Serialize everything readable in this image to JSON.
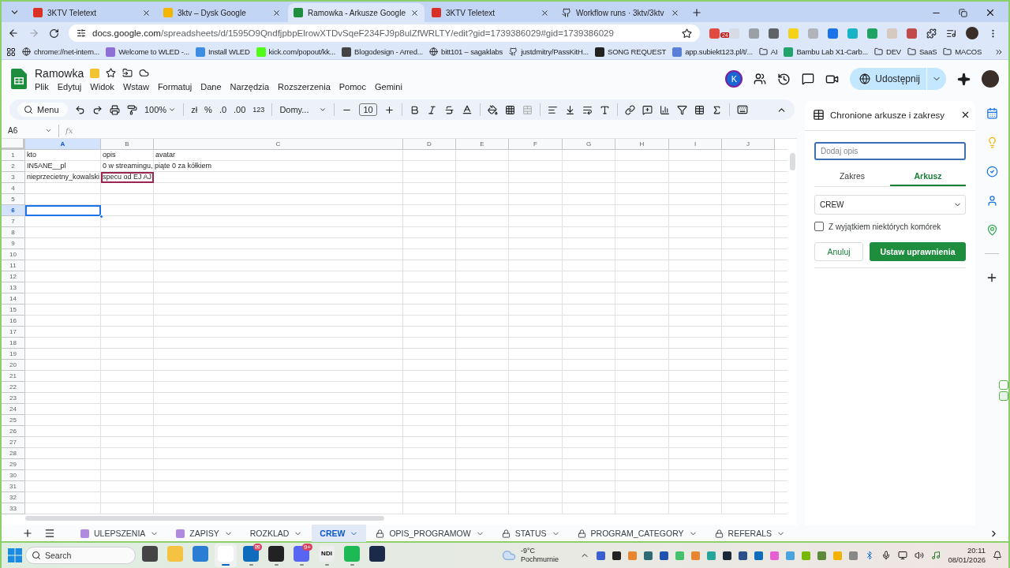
{
  "browser": {
    "tabs": [
      {
        "kind": "teletext",
        "title": "3KTV Teletext",
        "selected": false
      },
      {
        "kind": "drive",
        "title": "3ktv – Dysk Google",
        "selected": false
      },
      {
        "kind": "sheets",
        "title": "Ramowka - Arkusze Google",
        "selected": true
      },
      {
        "kind": "teletext",
        "title": "3KTV Teletext",
        "selected": false
      },
      {
        "kind": "github",
        "title": "Workflow runs · 3ktv/3ktv",
        "selected": false
      }
    ],
    "url_host": "docs.google.com",
    "url_path": "/spreadsheets/d/1595O9QndfjpbpElrowXTDvSqeF234FJ9p8ulZfWRLTY/edit?gid=1739386029#gid=1739386029",
    "extension_badge": "24",
    "bookmarks": [
      {
        "kind": "globe",
        "label": "chrome://net-intern..."
      },
      {
        "kind": "wled",
        "label": "Welcome to WLED -..."
      },
      {
        "kind": "app",
        "label": "Install WLED"
      },
      {
        "kind": "kick",
        "label": "kick.com/popout/kk..."
      },
      {
        "kind": "art",
        "label": "Blogodesign - Arred..."
      },
      {
        "kind": "globe",
        "label": "bitt101 – sagaklabs"
      },
      {
        "kind": "github",
        "label": "justdmitry/PassKitH..."
      },
      {
        "kind": "shield",
        "label": "SONG REQUEST"
      },
      {
        "kind": "numbers",
        "label": "app.subiekt123.pl/t/..."
      },
      {
        "kind": "folder",
        "label": "AI"
      },
      {
        "kind": "bambu",
        "label": "Bambu Lab X1-Carb..."
      },
      {
        "kind": "folder",
        "label": "DEV"
      },
      {
        "kind": "folder",
        "label": "SaaS"
      },
      {
        "kind": "folder",
        "label": "MACOS"
      }
    ]
  },
  "document": {
    "title": "Ramowka",
    "menus": [
      "Plik",
      "Edytuj",
      "Widok",
      "Wstaw",
      "Formatuj",
      "Dane",
      "Narzędzia",
      "Rozszerzenia",
      "Pomoc",
      "Gemini"
    ],
    "collaborator_initial": "K",
    "share_label": "Udostępnij"
  },
  "toolbar": {
    "search_label": "Menu",
    "zoom": "100%",
    "currency": "zł",
    "percent": "%",
    "decrease_decimals": ".0",
    "increase_decimals": ".00",
    "number_format": "123",
    "font": "Domy...",
    "font_size": "10"
  },
  "formula_bar": {
    "cell_ref": "A6",
    "fx": "fx"
  },
  "table": {
    "columns": [
      {
        "label": "A",
        "selected": true
      },
      {
        "label": "B",
        "selected": false
      },
      {
        "label": "C",
        "selected": false
      },
      {
        "label": "D",
        "selected": false
      },
      {
        "label": "E",
        "selected": false
      },
      {
        "label": "F",
        "selected": false
      },
      {
        "label": "G",
        "selected": false
      },
      {
        "label": "H",
        "selected": false
      },
      {
        "label": "I",
        "selected": false
      },
      {
        "label": "J",
        "selected": false
      }
    ],
    "rows": [
      {
        "number": "1",
        "selected": false,
        "cells": [
          {
            "text": "kto",
            "outlined": false
          },
          {
            "text": "opis",
            "outlined": false
          },
          {
            "text": "avatar",
            "outlined": false
          }
        ]
      },
      {
        "number": "2",
        "selected": false,
        "cells": [
          {
            "text": "IN5ANE__pl",
            "outlined": false
          },
          {
            "text": "0 w streamingu, piąte 0 za kółkiem",
            "outlined": false
          }
        ]
      },
      {
        "number": "3",
        "selected": false,
        "cells": [
          {
            "text": "nieprzecietny_kowalski",
            "outlined": false
          },
          {
            "text": "specu od EJ AJ",
            "outlined": true
          }
        ]
      },
      {
        "number": "4",
        "selected": false,
        "cells": []
      },
      {
        "number": "5",
        "selected": false,
        "cells": []
      },
      {
        "number": "6",
        "selected": true,
        "cells": []
      },
      {
        "number": "7",
        "selected": false,
        "cells": []
      },
      {
        "number": "8",
        "selected": false,
        "cells": []
      },
      {
        "number": "9",
        "selected": false,
        "cells": []
      },
      {
        "number": "10",
        "selected": false,
        "cells": []
      },
      {
        "number": "11",
        "selected": false,
        "cells": []
      },
      {
        "number": "12",
        "selected": false,
        "cells": []
      },
      {
        "number": "13",
        "selected": false,
        "cells": []
      },
      {
        "number": "14",
        "selected": false,
        "cells": []
      },
      {
        "number": "15",
        "selected": false,
        "cells": []
      },
      {
        "number": "16",
        "selected": false,
        "cells": []
      },
      {
        "number": "17",
        "selected": false,
        "cells": []
      },
      {
        "number": "18",
        "selected": false,
        "cells": []
      },
      {
        "number": "19",
        "selected": false,
        "cells": []
      },
      {
        "number": "20",
        "selected": false,
        "cells": []
      },
      {
        "number": "21",
        "selected": false,
        "cells": []
      },
      {
        "number": "22",
        "selected": false,
        "cells": []
      },
      {
        "number": "23",
        "selected": false,
        "cells": []
      },
      {
        "number": "24",
        "selected": false,
        "cells": []
      },
      {
        "number": "25",
        "selected": false,
        "cells": []
      },
      {
        "number": "26",
        "selected": false,
        "cells": []
      },
      {
        "number": "27",
        "selected": false,
        "cells": []
      },
      {
        "number": "28",
        "selected": false,
        "cells": []
      },
      {
        "number": "29",
        "selected": false,
        "cells": []
      },
      {
        "number": "30",
        "selected": false,
        "cells": []
      },
      {
        "number": "31",
        "selected": false,
        "cells": []
      },
      {
        "number": "32",
        "selected": false,
        "cells": []
      },
      {
        "number": "33",
        "selected": false,
        "cells": []
      }
    ]
  },
  "side_panel": {
    "title": "Chronione arkusze i zakresy",
    "description_placeholder": "Dodaj opis",
    "tabs": [
      {
        "label": "Zakres",
        "selected": false
      },
      {
        "label": "Arkusz",
        "selected": true
      }
    ],
    "sheet_select": "CREW",
    "exception_checkbox": {
      "label": "Z wyjątkiem niektórych komórek",
      "checked": false
    },
    "cancel_label": "Anuluj",
    "confirm_label": "Ustaw uprawnienia"
  },
  "sheet_tabs": [
    {
      "kind": "table",
      "label": "ULEPSZENIA",
      "selected": false
    },
    {
      "kind": "table",
      "label": "ZAPISY",
      "selected": false
    },
    {
      "kind": "plain",
      "label": "ROZKLAD",
      "selected": false
    },
    {
      "kind": "plain",
      "label": "CREW",
      "selected": true
    },
    {
      "kind": "locked",
      "label": "OPIS_PROGRAMOW",
      "selected": false
    },
    {
      "kind": "locked",
      "label": "STATUS",
      "selected": false
    },
    {
      "kind": "locked",
      "label": "PROGRAM_CATEGORY",
      "selected": false
    },
    {
      "kind": "locked",
      "label": "REFERALS",
      "selected": false
    }
  ],
  "taskbar": {
    "search_placeholder": "Search",
    "apps": [
      {
        "running": false,
        "active": false
      },
      {
        "running": false,
        "active": false
      },
      {
        "running": false,
        "active": false
      },
      {
        "running": true,
        "active": true
      },
      {
        "running": true,
        "active": false,
        "badge": "✉"
      },
      {
        "running": true,
        "active": false
      },
      {
        "running": true,
        "active": false,
        "badge": "9+"
      },
      {
        "running": true,
        "active": false,
        "label": "NDI"
      },
      {
        "running": true,
        "active": false
      },
      {
        "running": false,
        "active": false
      }
    ],
    "temperature": "-9°C",
    "weather": "Pochmurnie",
    "time": "20:11",
    "date": "08/01/2026"
  }
}
